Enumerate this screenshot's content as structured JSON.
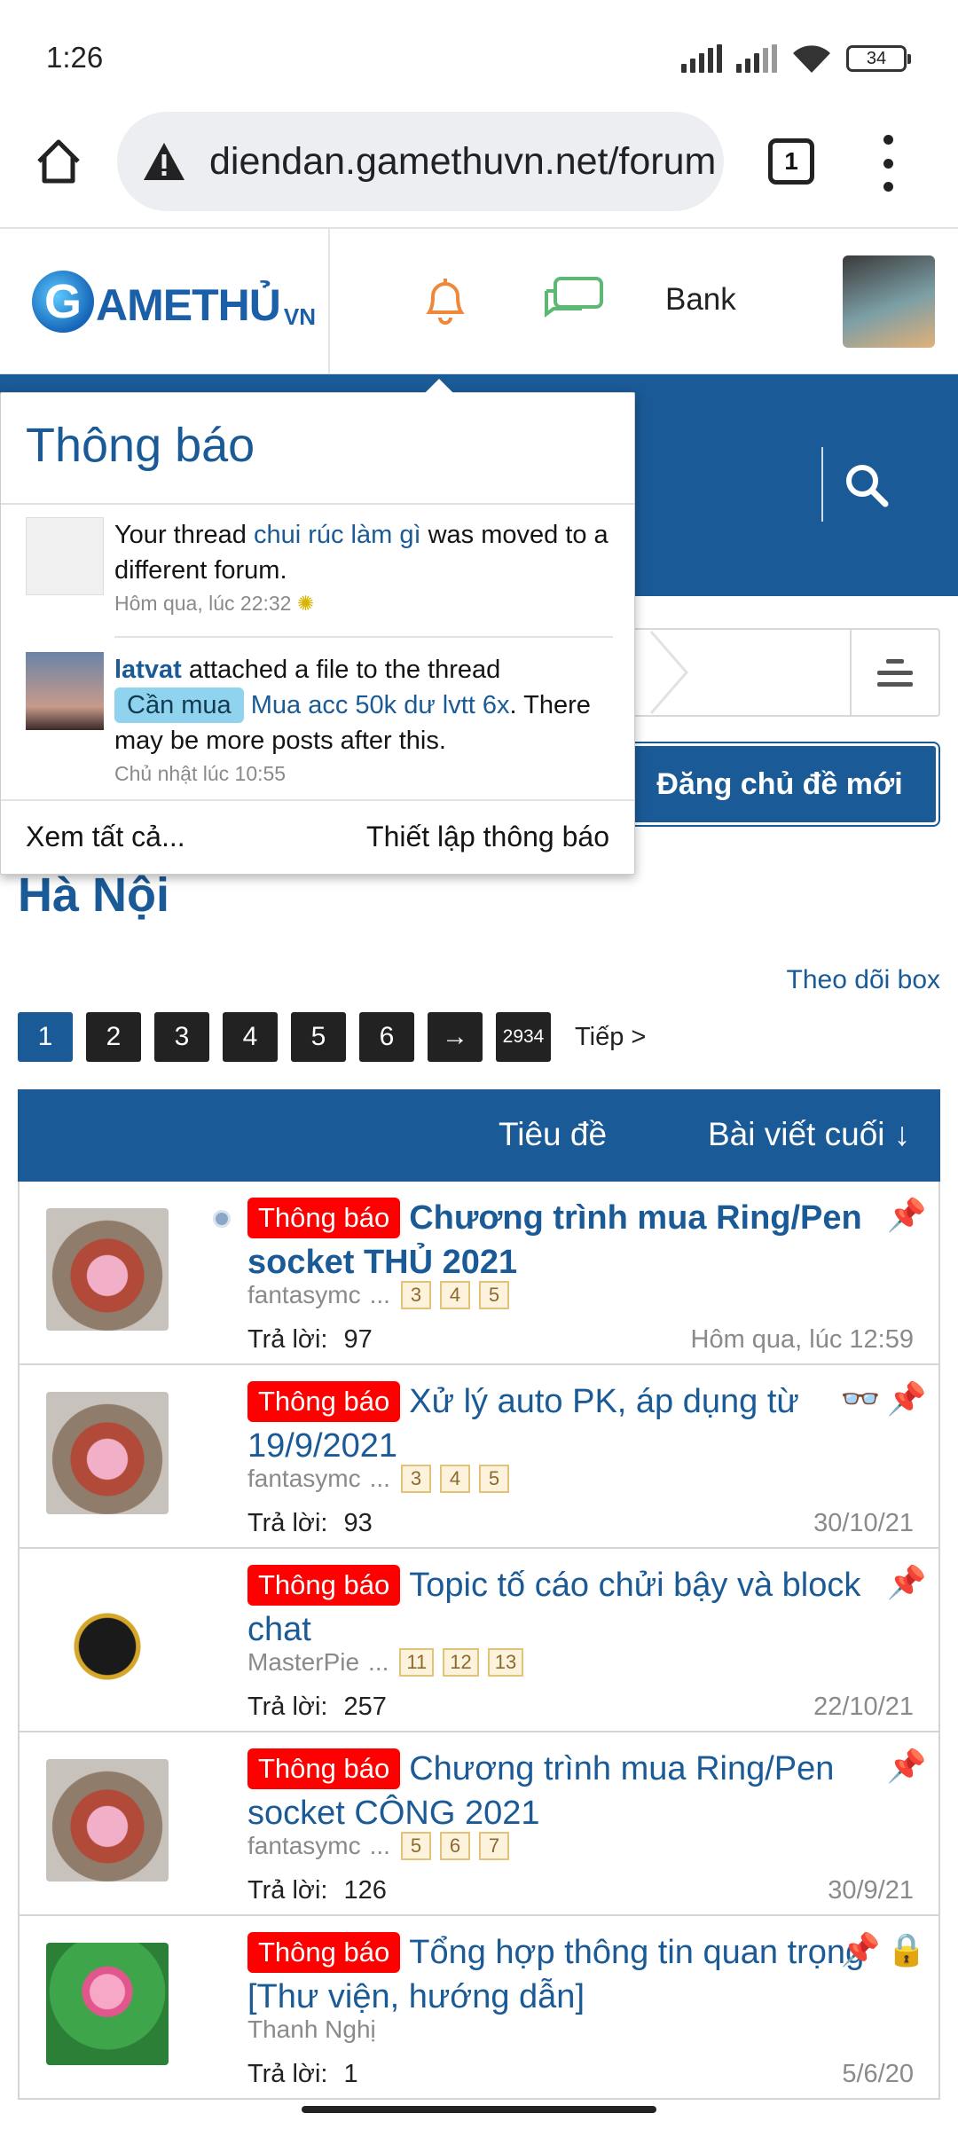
{
  "status": {
    "time": "1:26",
    "battery": "34"
  },
  "browser": {
    "url": "diendan.gamethuvn.net/forum",
    "tab_count": "1"
  },
  "header": {
    "logo_text": "AMETHỦ",
    "logo_g": "G",
    "logo_suffix": "VN",
    "bank_label": "Bank"
  },
  "notifications": {
    "title": "Thông báo",
    "items": [
      {
        "prefix": "Your thread ",
        "link": "chui rúc làm gì",
        "suffix": " was moved to a different forum.",
        "time": "Hôm qua, lúc 22:32"
      },
      {
        "user": "latvat",
        "prefix": " attached a file to the thread ",
        "tag": "Cần mua",
        "link": "Mua acc 50k dư lvtt 6x",
        "suffix": ". There may be more posts after this.",
        "time": "Chủ nhật lúc 10:55"
      }
    ],
    "view_all": "Xem tất cả...",
    "settings": "Thiết lập thông báo"
  },
  "actions": {
    "new_thread": "Đăng chủ đề mới",
    "follow": "Theo dõi box"
  },
  "forum": {
    "title": "Hà Nội"
  },
  "pagination": {
    "pages": [
      "1",
      "2",
      "3",
      "4",
      "5",
      "6",
      "→",
      "2934"
    ],
    "current": "1",
    "next": "Tiếp >"
  },
  "list": {
    "col_title": "Tiêu đề",
    "col_last": "Bài viết cuối ↓",
    "replies_label": "Trả lời:",
    "threads": [
      {
        "badge": "Thông báo",
        "title": "Chương trình mua Ring/Pen socket THỦ 2021",
        "author": "fantasymc",
        "pages": [
          "3",
          "4",
          "5"
        ],
        "replies": "97",
        "last": "Hôm qua, lúc 12:59",
        "avatar": "dragon",
        "bold": true
      },
      {
        "badge": "Thông báo",
        "title": "Xử lý auto PK, áp dụng từ 19/9/2021",
        "author": "fantasymc",
        "pages": [
          "3",
          "4",
          "5"
        ],
        "replies": "93",
        "last": "30/10/21",
        "avatar": "dragon",
        "bold": false
      },
      {
        "badge": "Thông báo",
        "title": "Topic tố cáo chửi bậy và block chat",
        "author": "MasterPie",
        "pages": [
          "11",
          "12",
          "13"
        ],
        "replies": "257",
        "last": "22/10/21",
        "avatar": "vip",
        "bold": false
      },
      {
        "badge": "Thông báo",
        "title": "Chương trình mua Ring/Pen socket CÔNG 2021",
        "author": "fantasymc",
        "pages": [
          "5",
          "6",
          "7"
        ],
        "replies": "126",
        "last": "30/9/21",
        "avatar": "dragon",
        "bold": false
      },
      {
        "badge": "Thông báo",
        "title": "Tổng hợp thông tin quan trọng [Thư viện, hướng dẫn]",
        "author": "Thanh Nghị",
        "pages": [],
        "replies": "1",
        "last": "5/6/20",
        "avatar": "lotus",
        "bold": false
      }
    ]
  },
  "colors": {
    "primary": "#1a5a96",
    "badge": "#ff0000",
    "tag": "#8fd3ee"
  }
}
